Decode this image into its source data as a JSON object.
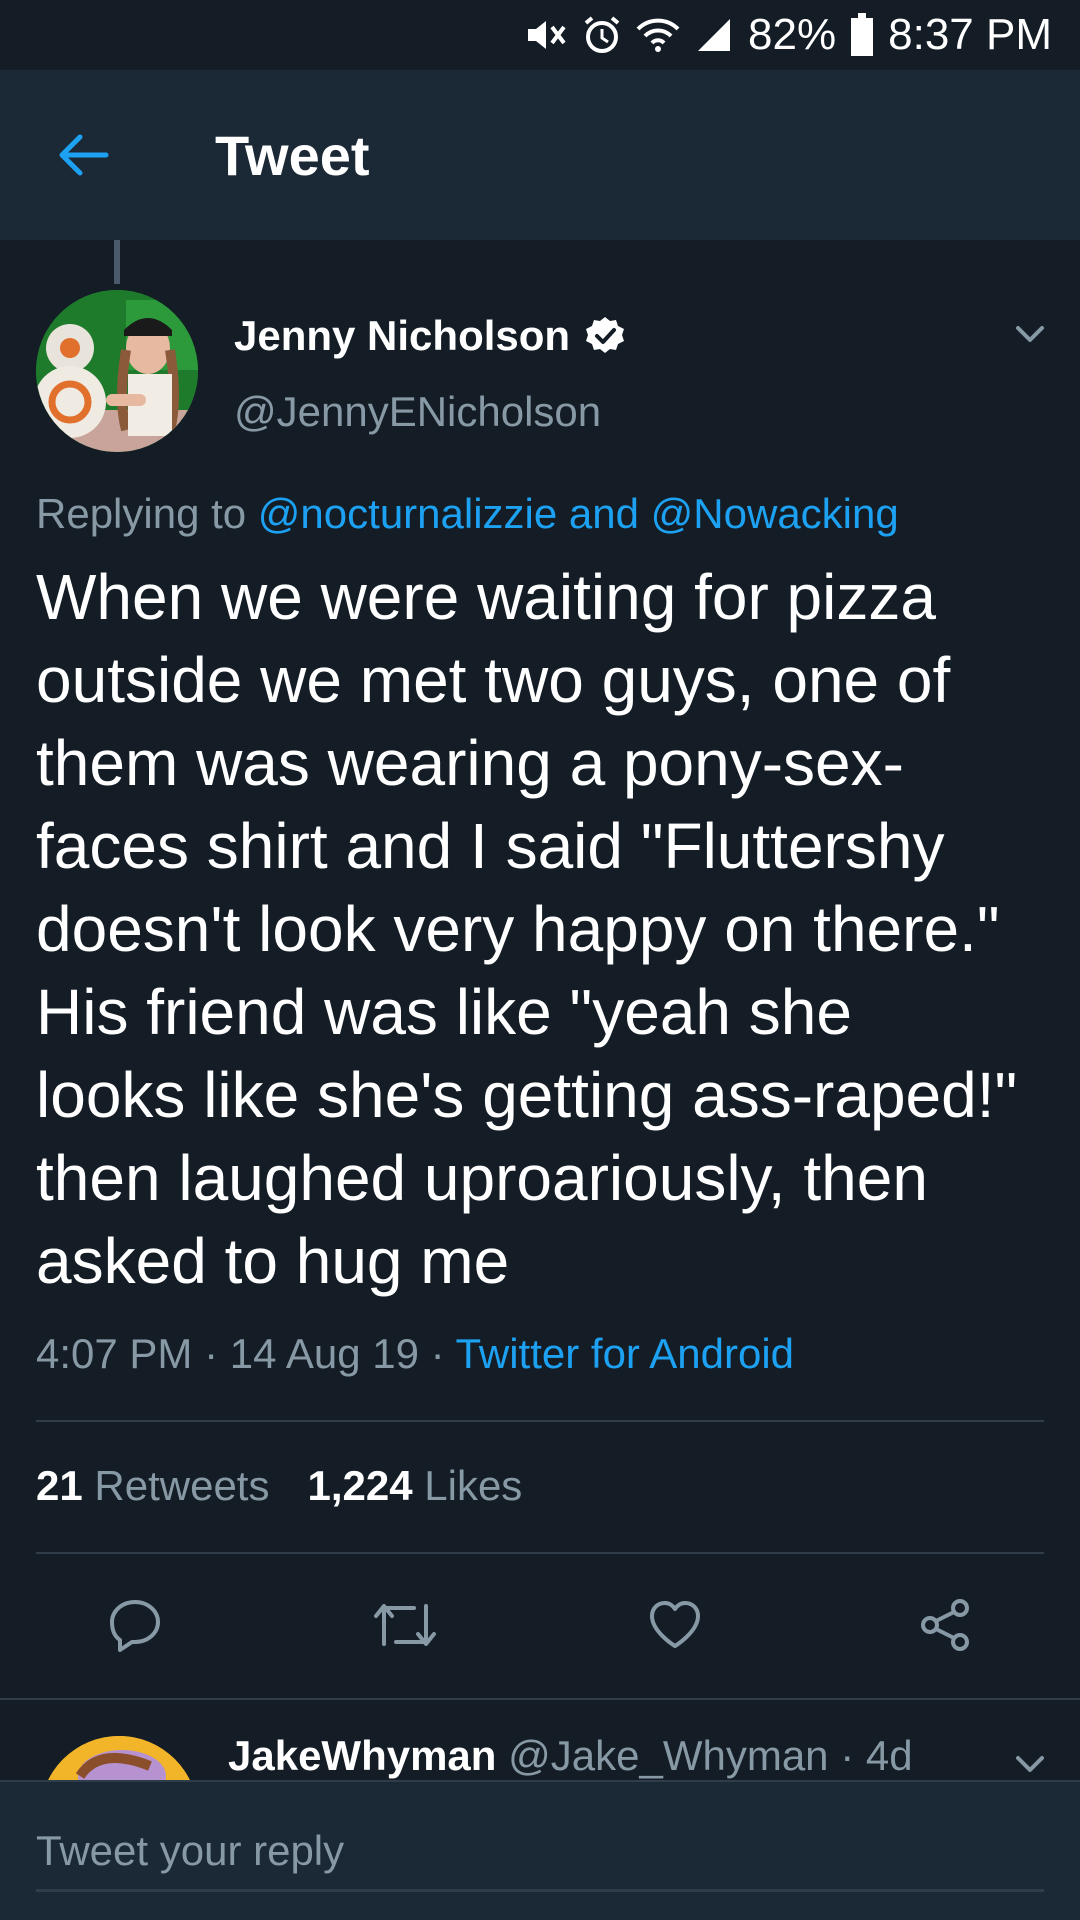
{
  "status_bar": {
    "battery": "82%",
    "time": "8:37 PM"
  },
  "header": {
    "title": "Tweet"
  },
  "tweet": {
    "author_name": "Jenny Nicholson",
    "author_handle": "@JennyENicholson",
    "verified": true,
    "replying_prefix": "Replying to",
    "replying_user1": "@nocturnalizzie",
    "replying_and": "and",
    "replying_user2": "@Nowacking",
    "text": "When we were waiting for pizza\noutside we met two guys, one of\nthem was wearing a pony-sex-\nfaces shirt and I said \"Fluttershy\ndoesn't look very happy on there.\"\nHis friend was like \"yeah she\nlooks like she's getting ass-raped!\"\nthen laughed uproariously, then\nasked to hug me",
    "time": "4:07 PM",
    "date": "14 Aug 19",
    "separator": "·",
    "source": "Twitter for Android",
    "retweets_count": "21",
    "retweets_label": "Retweets",
    "likes_count": "1,224",
    "likes_label": "Likes"
  },
  "icons": {
    "back": "arrow-left-icon",
    "verified": "verified-badge-icon",
    "caret": "chevron-down-icon",
    "reply": "reply-bubble-icon",
    "retweet": "retweet-icon",
    "like": "heart-icon",
    "share": "share-icon"
  },
  "reply_preview": {
    "name": "JakeWhyman",
    "handle": "@Jake_Whyman",
    "age": "4d"
  },
  "compose": {
    "placeholder": "Tweet your reply"
  },
  "colors": {
    "background": "#141d26",
    "header": "#1b2836",
    "accent": "#1da1f2",
    "muted": "#8899a6"
  }
}
